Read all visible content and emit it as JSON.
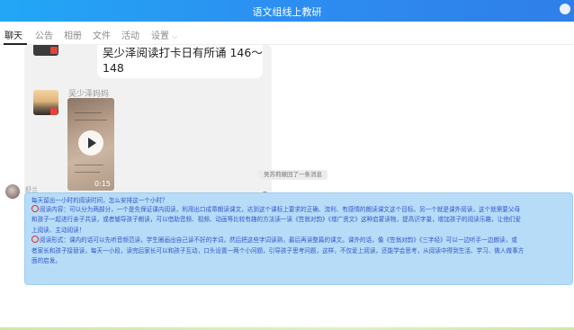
{
  "window": {
    "title": "语文组线上教研"
  },
  "tabs": [
    {
      "label": "聊天",
      "active": true
    },
    {
      "label": "公告"
    },
    {
      "label": "相册"
    },
    {
      "label": "文件"
    },
    {
      "label": "活动"
    },
    {
      "label": "设置"
    }
  ],
  "messages": {
    "shared_text": "吴少泽阅读打卡日有所诵 146～148",
    "video_sender": "吴少泽妈妈",
    "video_duration": "0:15",
    "recall_notice": "吴苏莉撤回了一条消息",
    "teacher_name": "舒兰",
    "long_message": {
      "line1": "每天留出一小时的阅读时间，怎么安排这一个小时？",
      "line2": "阅读内容：可以分为两部分，一个是先保证课内阅读，利用出口成章朗读课文，达到这个课标上要求的正确、流利、有感情的朗读课文这个目标。另一个就是课外阅读，这个就需要父母",
      "line3": "和孩子一起进行亲子共读，或者辅导孩子朗读，可以借助音频、视频、动画等比较有趣的方法读一读《笠翁对韵》《增广贤文》这种启蒙读物，提高识字量，增加孩子的阅读乐趣，让他们爱",
      "line4": "上阅读、主动阅读！",
      "line5": "阅读形式：课内的话可以先听音频范读，学生圈画出自己读不好的字词，然后把这些字词读熟，最后再读整篇的课文。课外的话，像《笠翁对韵》《三字经》可以一边听手一边朗读，或",
      "line6": "者家长和孩子接替读，每天一小段，读完后家长可以和孩子互动，口头设置一两个小问题，引导孩子思考问题，这样，不仅爱上阅读，还能学会思考，从阅读中得到生活、学习、做人做事方",
      "line7": "面的启发。"
    }
  },
  "colors": {
    "titlebar": "#2d8cf0",
    "highlight": "#b7dcf7",
    "message_text": "#3356c8",
    "ring": "#e02d2d"
  }
}
